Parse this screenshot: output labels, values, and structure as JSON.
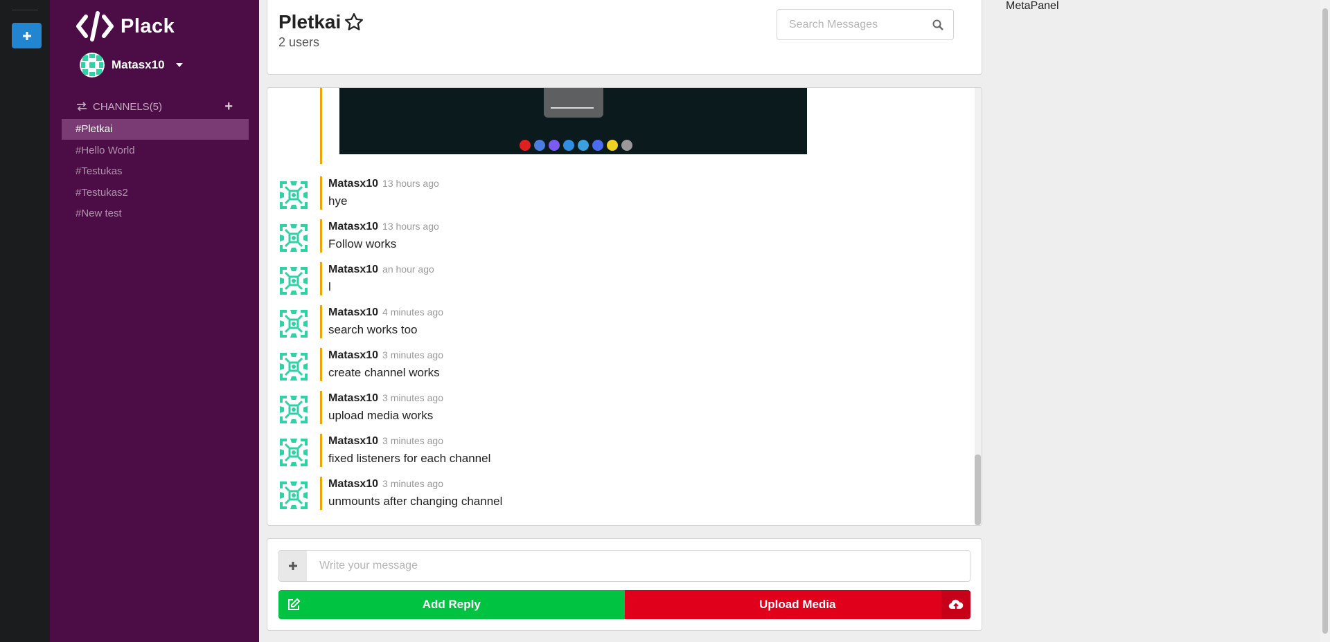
{
  "app": {
    "name": "Plack"
  },
  "user": {
    "name": "Matasx10"
  },
  "channels": {
    "header": "CHANNELS",
    "count": "(5)",
    "items": [
      {
        "label": "#Pletkai"
      },
      {
        "label": "#Hello World"
      },
      {
        "label": "#Testukas"
      },
      {
        "label": "#Testukas2"
      },
      {
        "label": "#New test"
      }
    ]
  },
  "channel_header": {
    "title": "Pletkai",
    "users": "2 users",
    "search_placeholder": "Search Messages"
  },
  "messages": [
    {
      "author": "Matasx10",
      "time": "13 hours ago",
      "text": "hye"
    },
    {
      "author": "Matasx10",
      "time": "13 hours ago",
      "text": "Follow works"
    },
    {
      "author": "Matasx10",
      "time": "an hour ago",
      "text": "l"
    },
    {
      "author": "Matasx10",
      "time": "4 minutes ago",
      "text": "search works too"
    },
    {
      "author": "Matasx10",
      "time": "3 minutes ago",
      "text": "create channel works"
    },
    {
      "author": "Matasx10",
      "time": "3 minutes ago",
      "text": "upload media works"
    },
    {
      "author": "Matasx10",
      "time": "3 minutes ago",
      "text": "fixed listeners for each channel"
    },
    {
      "author": "Matasx10",
      "time": "3 minutes ago",
      "text": "unmounts after changing channel"
    }
  ],
  "composer": {
    "placeholder": "Write your message",
    "add_reply": "Add Reply",
    "upload_media": "Upload Media"
  },
  "metapanel": {
    "title": "MetaPanel"
  },
  "colors": {
    "sidebar": "#4c0d46",
    "sidebar_active": "#7a3a74",
    "accent_bar": "#f2a400",
    "add_reply": "#00c441",
    "upload_media": "#e0001b",
    "color_panel_add": "#2185d0"
  }
}
